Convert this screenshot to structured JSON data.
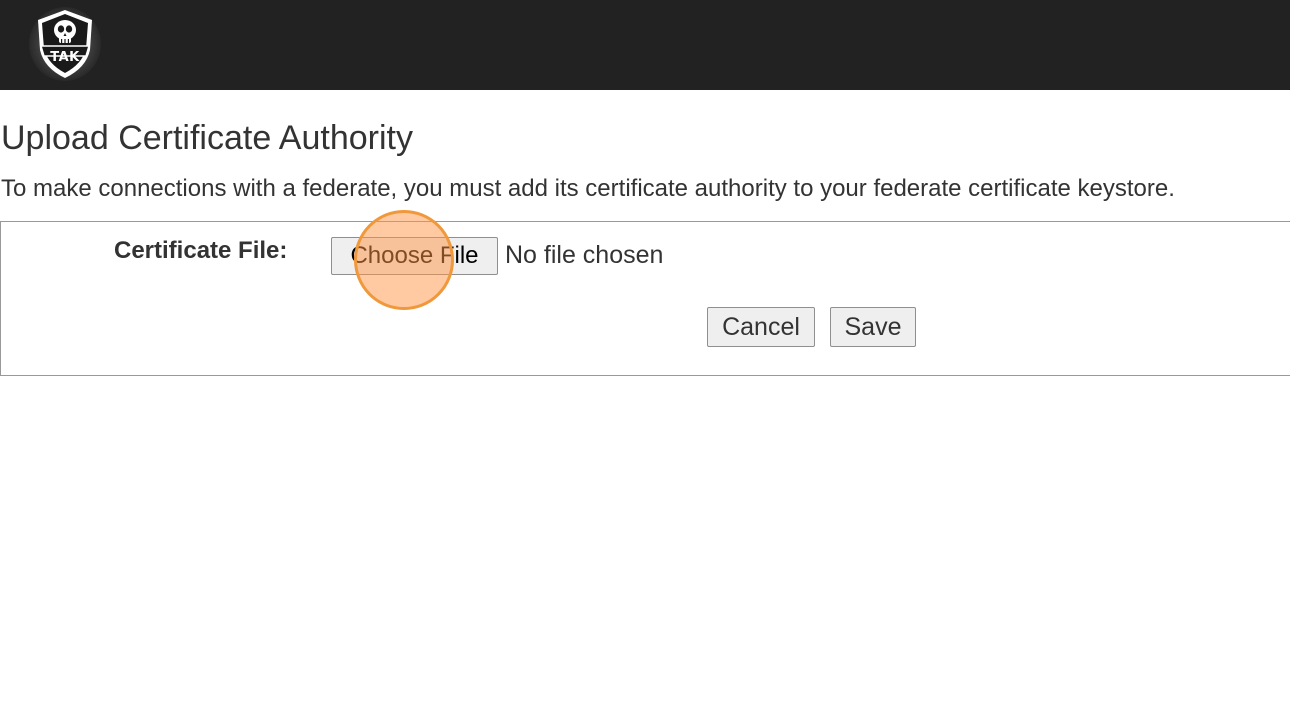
{
  "header": {
    "logo_text": "TAK",
    "background_color": "#222222"
  },
  "page": {
    "title": "Upload Certificate Authority",
    "intro": "To make connections with a federate, you must add its certificate authority to your federate certificate keystore."
  },
  "form": {
    "certificate_label": "Certificate File:",
    "file_button_label": "Choose File",
    "file_status": "No file chosen",
    "cancel_label": "Cancel",
    "save_label": "Save"
  },
  "overlay": {
    "click_indicator_color": "#f0983c"
  }
}
